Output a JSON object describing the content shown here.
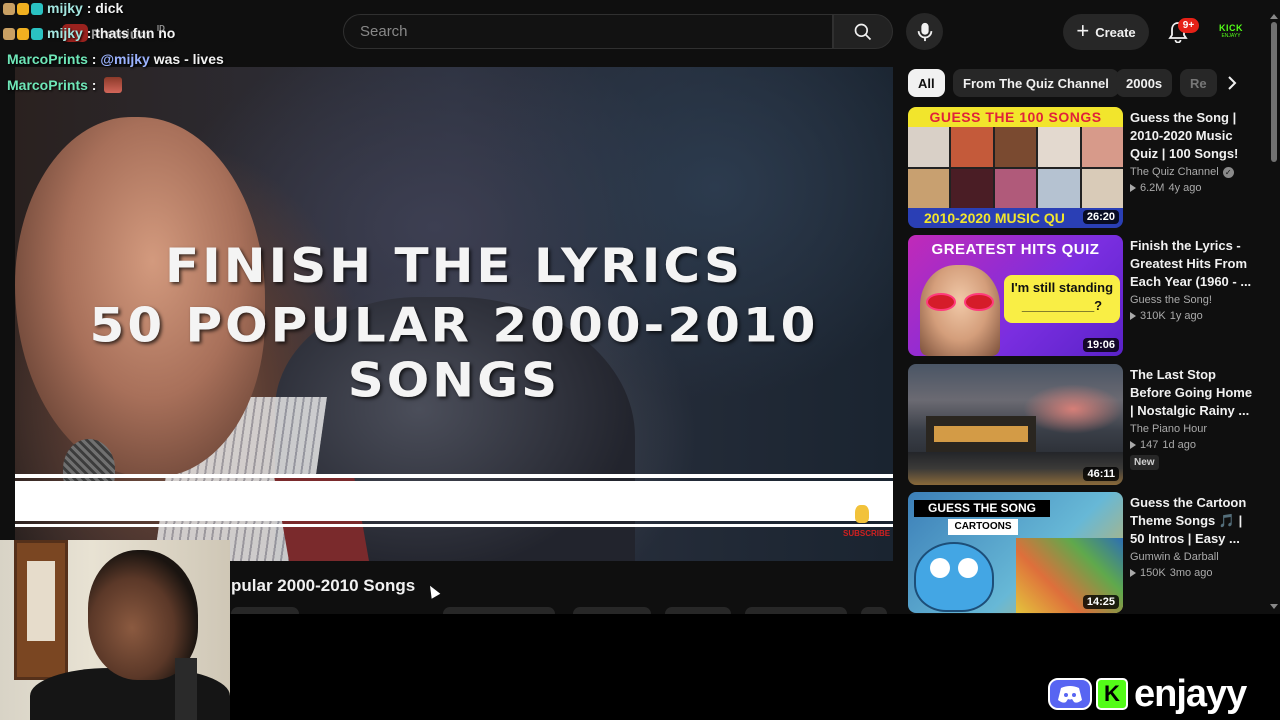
{
  "header": {
    "search_placeholder": "Search",
    "create_label": "Create",
    "notification_count": "9+",
    "avatar_text": "KICK",
    "avatar_subtext": "ENJAYY"
  },
  "player": {
    "overlay_line1": "FINISH THE LYRICS",
    "overlay_line2": "50 POPULAR 2000-2010 SONGS",
    "subscribe_hint": "SUBSCRIBE"
  },
  "video_title": "pular 2000-2010 Songs",
  "chips": [
    {
      "label": "All"
    },
    {
      "label": "From The Quiz Channel"
    },
    {
      "label": "2000s"
    },
    {
      "label": "Re"
    }
  ],
  "recommended": [
    {
      "title": "Guess the Song | 2010-2020 Music Quiz | 100 Songs!",
      "channel": "The Quiz Channel",
      "verified": true,
      "views": "6.2M",
      "age": "4y ago",
      "duration": "26:20",
      "thumb_top_text": "GUESS THE 100 SONGS",
      "thumb_bottom_text": "2010-2020 MUSIC QU"
    },
    {
      "title": "Finish the Lyrics - Greatest Hits From Each Year (1960 - ...",
      "channel": "Guess the Song!",
      "verified": false,
      "views": "310K",
      "age": "1y ago",
      "duration": "19:06",
      "thumb_header": "GREATEST HITS QUIZ",
      "thumb_bubble_line1": "I'm still standing",
      "thumb_bubble_line2": "__________?"
    },
    {
      "title": "The Last Stop Before Going Home | Nostalgic Rainy ...",
      "channel": "The Piano Hour",
      "verified": false,
      "views": "147",
      "age": "1d ago",
      "duration": "46:11",
      "badge": "New"
    },
    {
      "title": "Guess the Cartoon Theme Songs 🎵 | 50 Intros | Easy ...",
      "channel": "Gumwin & Darball",
      "verified": false,
      "views": "150K",
      "age": "3mo ago",
      "duration": "14:25",
      "thumb_header": "GUESS THE SONG",
      "thumb_sub": "CARTOONS"
    }
  ],
  "chat": [
    {
      "user": "mijky",
      "message": "dick"
    },
    {
      "user": "mijky",
      "message": "thats fun no"
    },
    {
      "user": "MarcoPrints",
      "mention": "@mijky",
      "message": "was - lives"
    },
    {
      "user": "MarcoPrints",
      "message": ""
    }
  ],
  "overlay_ghost": {
    "text": "Premium",
    "id": "ID"
  },
  "branding": {
    "kick_letter": "K",
    "name": "enjayy"
  },
  "colors": {
    "background": "#0f0f0f",
    "chip_active": "#f1f1f1",
    "notification_badge": "#e62117",
    "kick_green": "#53fc18",
    "discord_blurple": "#5865f2"
  }
}
